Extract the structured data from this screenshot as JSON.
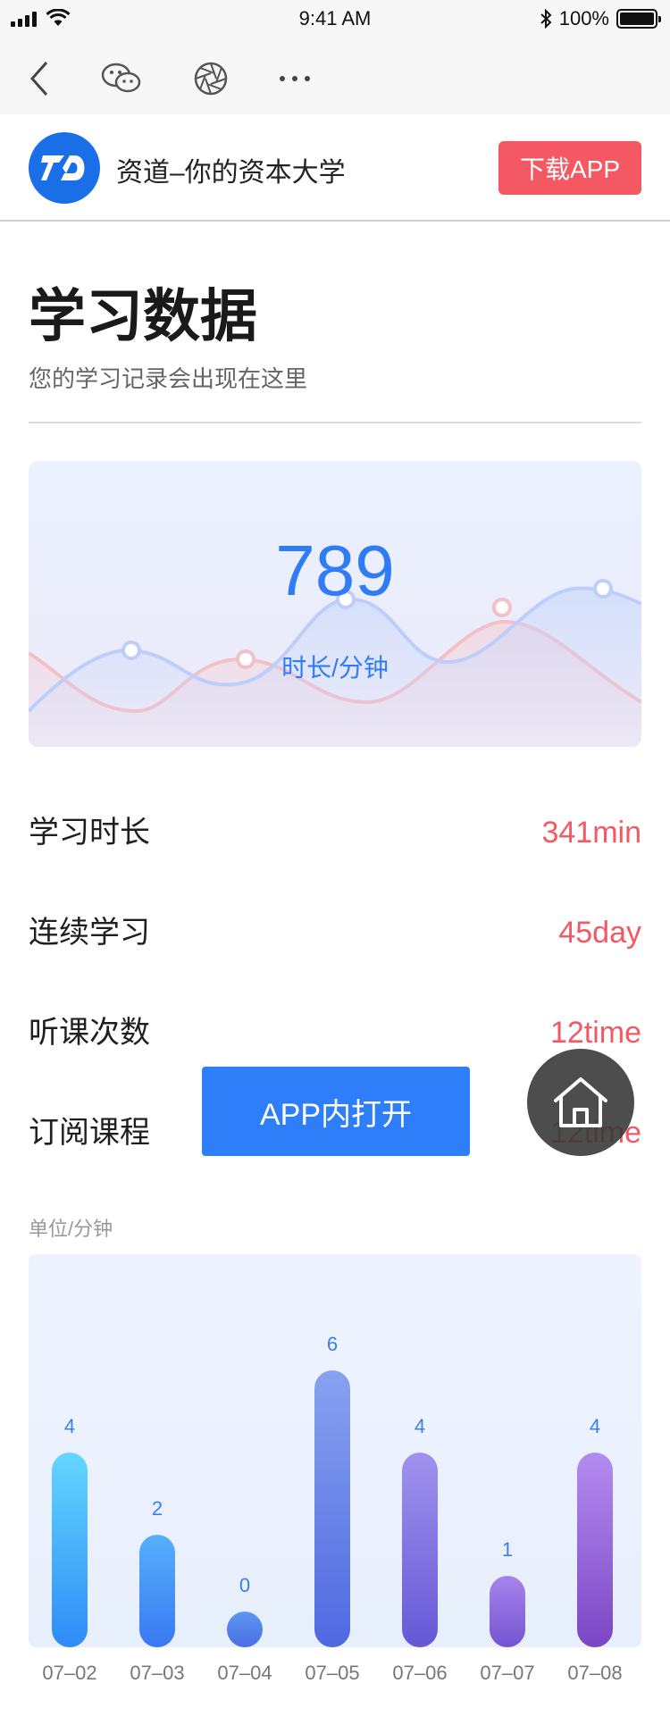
{
  "status_bar": {
    "time": "9:41 AM",
    "battery": "100%"
  },
  "banner": {
    "app_name": "资道–你的资本大学",
    "download_label": "下载APP"
  },
  "heading": {
    "title": "学习数据",
    "subtitle": "您的学习记录会出现在这里"
  },
  "summary": {
    "total": "789",
    "label": "时长/分钟"
  },
  "stats": [
    {
      "label": "学习时长",
      "value": "341min"
    },
    {
      "label": "连续学习",
      "value": "45day"
    },
    {
      "label": "听课次数",
      "value": "12time"
    },
    {
      "label": "订阅课程",
      "value": "12time"
    }
  ],
  "overlay": {
    "open_app_label": "APP内打开"
  },
  "icons": [
    "back-icon",
    "wechat-icon",
    "moments-icon",
    "more-icon",
    "home-icon"
  ],
  "colors": {
    "accent_blue": "#2f7cf6",
    "accent_red": "#f35863"
  },
  "chart_unit": "单位/分钟",
  "chart_data": {
    "type": "bar",
    "categories": [
      "07–02",
      "07–03",
      "07–04",
      "07–05",
      "07–06",
      "07–07",
      "07–08"
    ],
    "values": [
      4,
      2,
      0,
      6,
      4,
      1,
      4
    ],
    "ylim": [
      0,
      6
    ]
  }
}
